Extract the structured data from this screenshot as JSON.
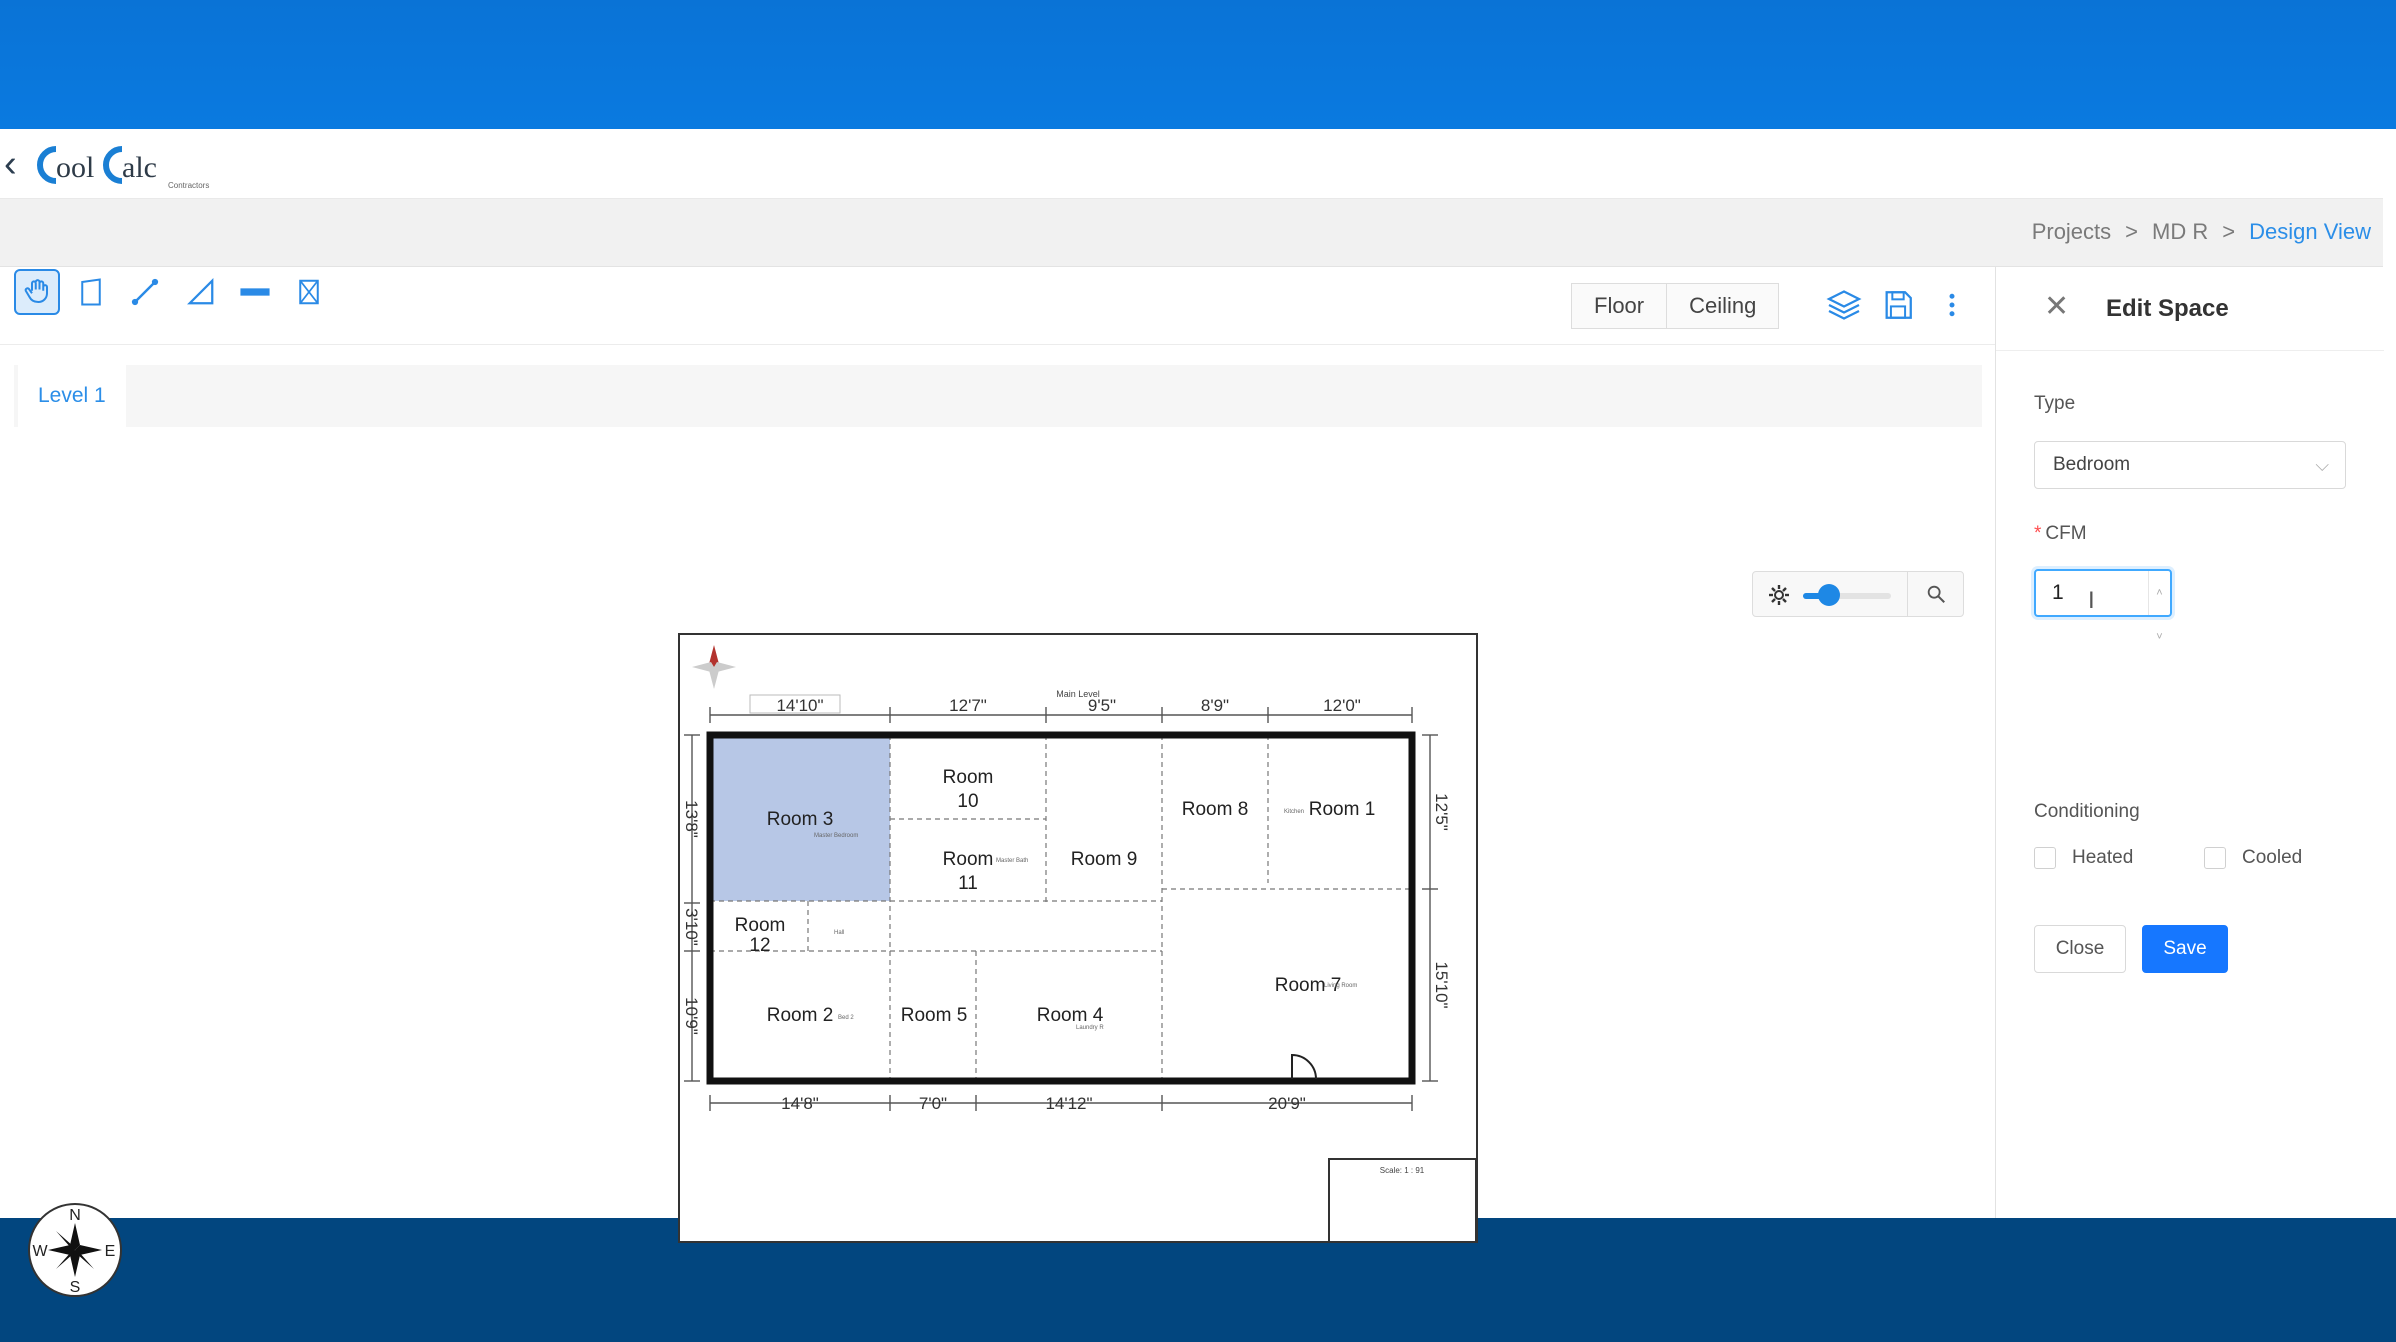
{
  "header": {
    "back_icon": "chevron-left-icon",
    "logo_text": "Cool Calc",
    "logo_sub": "Contractors"
  },
  "breadcrumbs": [
    {
      "label": "Projects"
    },
    {
      "label": "MD R"
    },
    {
      "label": "Design View"
    }
  ],
  "breadcrumb_separator": ">",
  "toolbar": {
    "tools": [
      {
        "name": "pan-tool",
        "icon": "hand-icon",
        "active": true
      },
      {
        "name": "room-tool",
        "icon": "polygon-icon",
        "active": false
      },
      {
        "name": "line-tool",
        "icon": "line-icon",
        "active": false
      },
      {
        "name": "angle-wall-tool",
        "icon": "angle-icon",
        "active": false
      },
      {
        "name": "wall-tool",
        "icon": "wall-icon",
        "active": false
      },
      {
        "name": "window-tool",
        "icon": "window-icon",
        "active": false
      }
    ],
    "floor_label": "Floor",
    "ceiling_label": "Ceiling",
    "layers_icon": "layers-icon",
    "save_icon": "save-icon",
    "more_icon": "more-vertical-icon"
  },
  "tabs": {
    "level": "Level 1"
  },
  "zoom": {
    "level": 0.3,
    "icon_left": "settings-icon",
    "icon_right": "search-icon"
  },
  "floorplan": {
    "top_dims": [
      "14'10\"",
      "12'7\"",
      "9'5\"",
      "8'9\"",
      "12'0\""
    ],
    "bottom_dims": [
      "14'8\"",
      "7'0\"",
      "14'12\"",
      "20'9\""
    ],
    "left_dims": [
      "13'8\"",
      "3'10\"",
      "10'9\""
    ],
    "right_dims": [
      "12'5\"",
      "15'10\""
    ],
    "top_note": "Main Level",
    "scale_note": "Scale: 1 : 91",
    "rooms": {
      "room3": "Room 3",
      "room3_sub": "Master Bedroom",
      "room10a": "Room",
      "room10b": "10",
      "room11a": "Room",
      "room11b": "11",
      "room11_sub": "Master Bath",
      "room9": "Room 9",
      "room8": "Room 8",
      "room1": "Room 1",
      "room1_sub": "Kitchen",
      "room12a": "Room",
      "room12b": "12",
      "hall": "Hall",
      "room2": "Room 2",
      "room2_sub": "Bed 2",
      "room5": "Room 5",
      "room4": "Room 4",
      "room4_sub": "Laundry R",
      "room7": "Room 7",
      "room7_sub": "Living Room"
    }
  },
  "compass": {
    "n": "N",
    "s": "S",
    "e": "E",
    "w": "W"
  },
  "panel": {
    "title": "Edit Space",
    "close_icon": "close-icon",
    "type_label": "Type",
    "type_value": "Bedroom",
    "cfm_required": "*",
    "cfm_label": "CFM",
    "cfm_value": "1",
    "conditioning_label": "Conditioning",
    "heated_label": "Heated",
    "cooled_label": "Cooled",
    "close_button": "Close",
    "save_button": "Save"
  },
  "colors": {
    "accent": "#1677ff",
    "top_band": "#0a7ae0",
    "bottom_band": "#02467f",
    "selected_room": "#b7c7e6"
  }
}
